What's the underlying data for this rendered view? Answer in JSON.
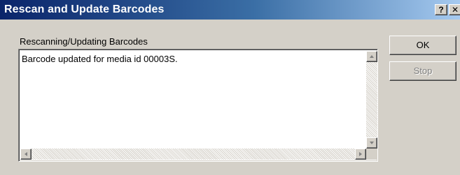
{
  "window": {
    "title": "Rescan and Update Barcodes",
    "help_label": "?",
    "close_label": "✕"
  },
  "group": {
    "label": "Rescanning/Updating Barcodes"
  },
  "log": {
    "lines": [
      "Barcode updated for media id 00003S."
    ]
  },
  "buttons": {
    "ok_label": "OK",
    "stop_label": "Stop",
    "stop_enabled": false
  },
  "colors": {
    "titlebar_start": "#0a246a",
    "titlebar_end": "#a6caf0",
    "face": "#d4d0c8"
  }
}
